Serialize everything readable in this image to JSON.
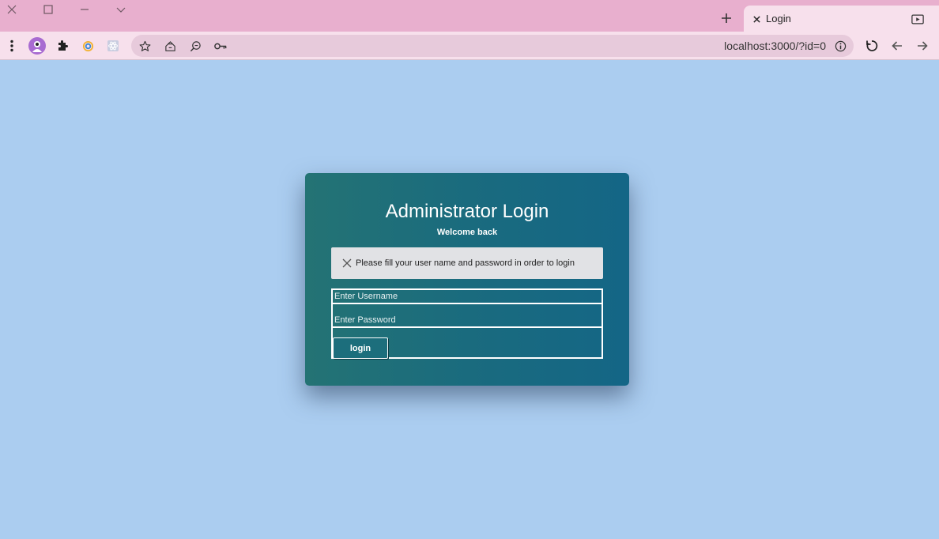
{
  "browser": {
    "tab": {
      "title": "Login"
    },
    "url": "localhost:3000/?id=0"
  },
  "page": {
    "title": "Administrator Login",
    "subtitle": "Welcome back",
    "alert": "Please fill your user name and password in order to login",
    "username_placeholder": "Enter Username",
    "password_placeholder": "Enter Password",
    "login_label": "login"
  },
  "colors": {
    "page_background": "#abcdf0",
    "card_gradient_start": "#247374",
    "card_gradient_end": "#146686",
    "titlebar": "#e8afce"
  }
}
